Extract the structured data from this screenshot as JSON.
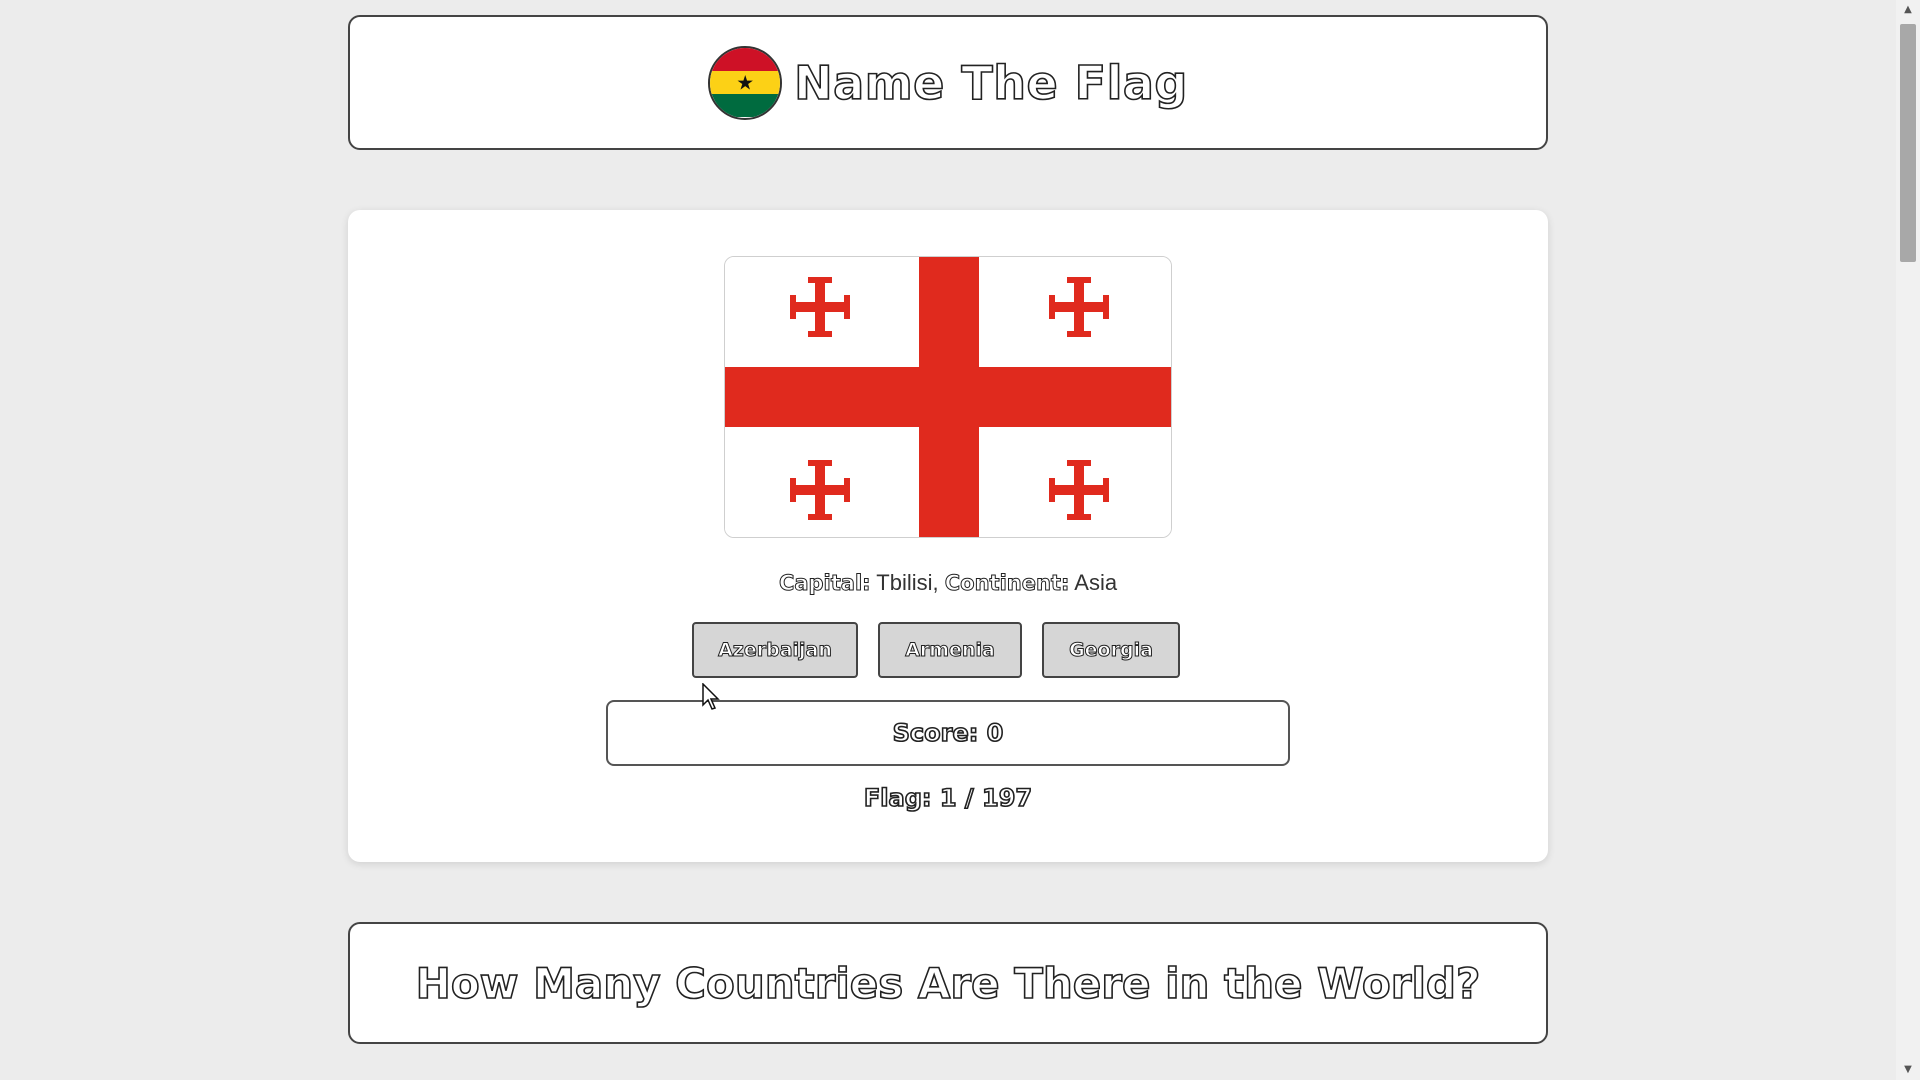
{
  "header": {
    "title": "Name The Flag",
    "logo_icon": "ghana-flag-icon",
    "logo_colors": {
      "red": "#ce1126",
      "yellow": "#fcd116",
      "green": "#006b3f",
      "star": "#000000"
    }
  },
  "quiz": {
    "flag_icon": "georgia-flag",
    "flag_colors": {
      "background": "#ffffff",
      "cross": "#e02a1e"
    },
    "capital_label": "Capital:",
    "capital_value": "Tbilisi,",
    "continent_label": "Continent:",
    "continent_value": "Asia",
    "options": [
      "Azerbaijan",
      "Armenia",
      "Georgia"
    ],
    "score_label": "Score: 0",
    "flag_progress": "Flag: 1 / 197"
  },
  "section": {
    "heading": "How Many Countries Are There in the World?"
  },
  "colors": {
    "page_background": "#ececec",
    "card_background": "#ffffff",
    "button_background": "#d6d6d6"
  }
}
